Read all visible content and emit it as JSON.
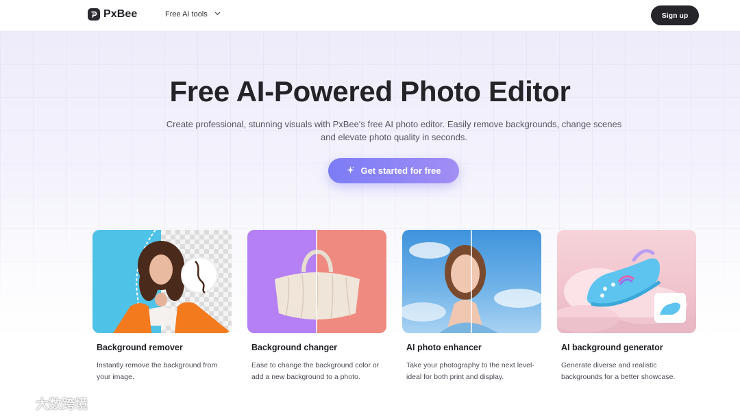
{
  "header": {
    "brand": "PxBee",
    "nav_tools_label": "Free AI tools",
    "signup_label": "Sign up"
  },
  "hero": {
    "title": "Free AI-Powered Photo Editor",
    "subtitle": "Create professional, stunning visuals with PxBee's free AI photo editor. Easily remove backgrounds, change scenes and elevate photo quality in seconds.",
    "cta_label": "Get started for free"
  },
  "cards": [
    {
      "title": "Background remover",
      "description": "Instantly remove the background from your image."
    },
    {
      "title": "Background changer",
      "description": "Ease to change the background color or add a new background to a photo."
    },
    {
      "title": "AI photo enhancer",
      "description": "Take your photography to the next level-ideal for both print and display."
    },
    {
      "title": "AI background generator",
      "description": "Generate diverse and realistic backgrounds for a better showcase."
    }
  ],
  "watermark": {
    "text": "大数跨境"
  },
  "colors": {
    "accent": "#8b86f6",
    "dark_button": "#25252a",
    "card_blue": "#4fc2e8",
    "card_purple": "#b680f5",
    "card_coral": "#ef8a80"
  },
  "icons": [
    "pxbee-logo-icon",
    "chevron-down-icon",
    "sparkle-icon"
  ]
}
